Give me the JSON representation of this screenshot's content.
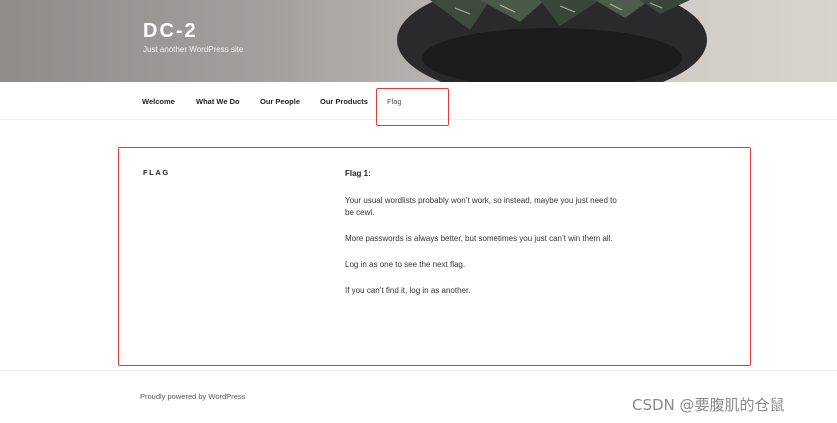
{
  "header": {
    "site_title": "DC-2",
    "tagline": "Just another WordPress site"
  },
  "nav": {
    "items": [
      {
        "label": "Welcome"
      },
      {
        "label": "What We Do"
      },
      {
        "label": "Our People"
      },
      {
        "label": "Our Products"
      },
      {
        "label": "Flag"
      }
    ]
  },
  "entry": {
    "title": "FLAG",
    "heading": "Flag 1:",
    "paragraphs": [
      "Your usual wordlists probably won’t work, so instead, maybe you just need to be cewl.",
      "More passwords is always better, but sometimes you just can’t win them all.",
      "Log in as one to see the next flag.",
      "If you can’t find it, log in as another."
    ]
  },
  "footer": {
    "credit": "Proudly powered by WordPress"
  },
  "watermark": "CSDN @要腹肌的仓鼠",
  "colors": {
    "highlight": "#e23b3b"
  }
}
